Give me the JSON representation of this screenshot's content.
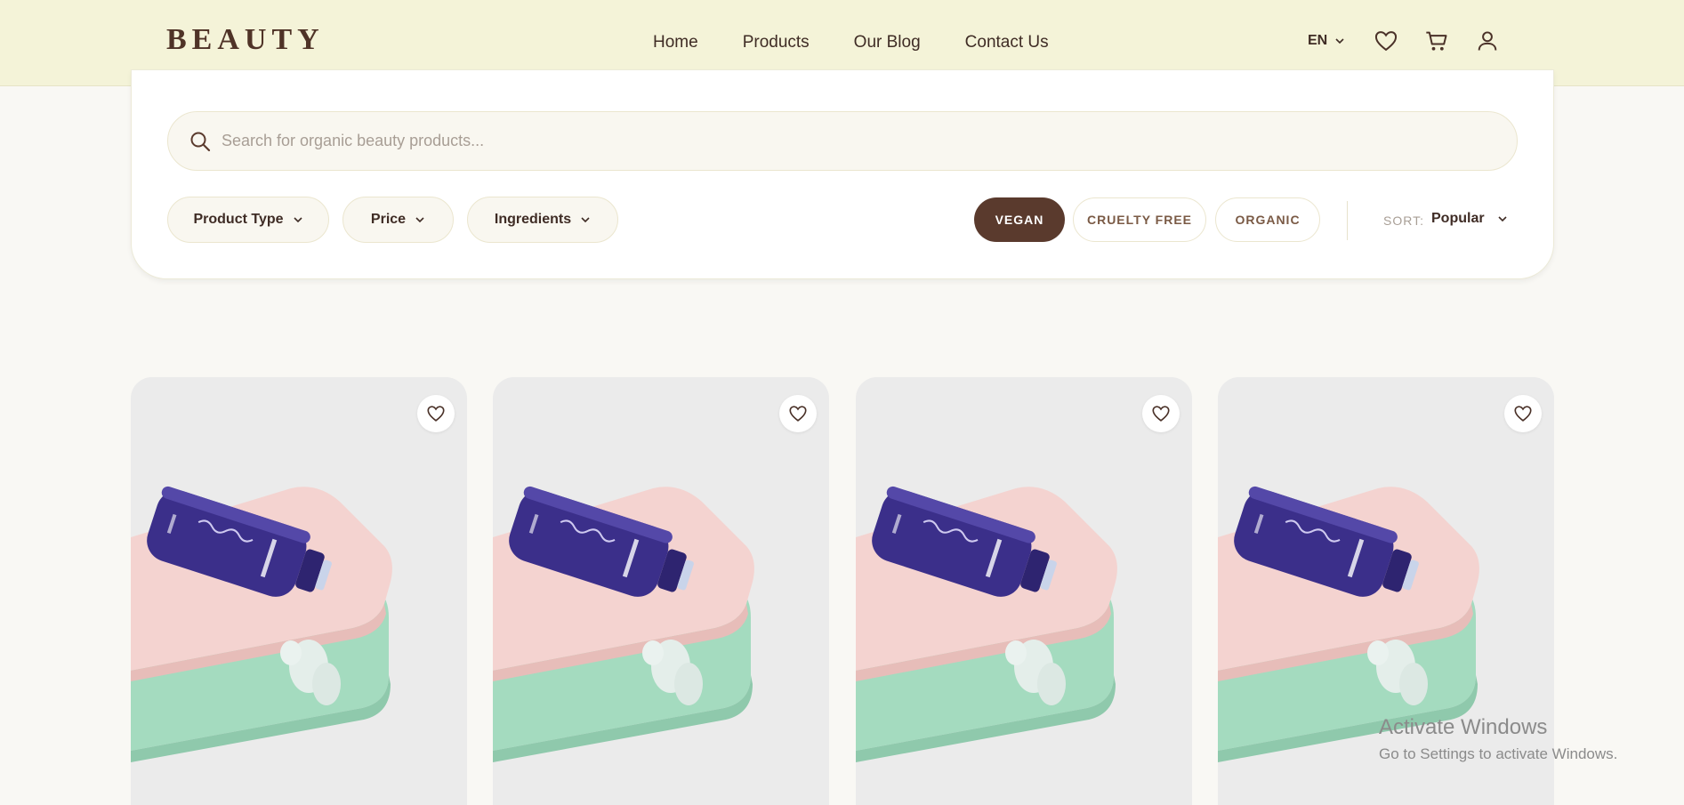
{
  "header": {
    "logo": "BEAUTY",
    "nav": [
      "Home",
      "Products",
      "Our Blog",
      "Contact Us"
    ],
    "language": "EN",
    "icons": [
      "heart-icon",
      "cart-icon",
      "user-icon"
    ]
  },
  "search": {
    "placeholder": "Search for organic beauty products..."
  },
  "filters": {
    "dropdowns": [
      "Product Type",
      "Price",
      "Ingredients"
    ],
    "tags": [
      {
        "label": "VEGAN",
        "active": true
      },
      {
        "label": "CRUELTY FREE",
        "active": false
      },
      {
        "label": "ORGANIC",
        "active": false
      }
    ],
    "sort_label": "SORT:",
    "sort_value": "Popular"
  },
  "products": [
    {
      "image": "product-photo"
    },
    {
      "image": "product-photo"
    },
    {
      "image": "product-photo"
    },
    {
      "image": "product-photo"
    }
  ],
  "watermark": {
    "title": "Activate Windows",
    "subtitle": "Go to Settings to activate Windows."
  },
  "colors": {
    "header_bg": "#f4f3d8",
    "accent": "#5a3a2d",
    "page_bg": "#f9f8f4"
  }
}
